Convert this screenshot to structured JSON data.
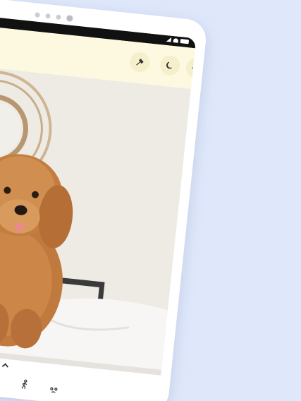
{
  "background_color": "#dfe8fb",
  "toolbar": {
    "buttons": [
      {
        "icon": "flashlight-icon"
      },
      {
        "icon": "moon-icon"
      },
      {
        "icon": "settings-gear-icon"
      }
    ]
  },
  "photo": {
    "subject": ""
  },
  "bottom_controls": [
    {
      "icon": "chevron-up-icon"
    },
    {
      "icon": "speaker-icon"
    },
    {
      "icon": "walking-person-icon"
    },
    {
      "icon": "paw-icon"
    }
  ]
}
